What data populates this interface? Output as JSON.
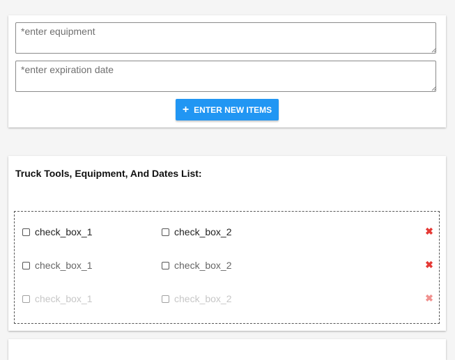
{
  "form": {
    "equipment_placeholder": "*enter equipment",
    "expiration_placeholder": "*enter expiration date",
    "enter_button_label": "ENTER NEW ITEMS",
    "enter_button_icon": "+"
  },
  "list": {
    "title": "Truck Tools, Equipment, And Dates List:",
    "rows": [
      {
        "check1": "check_box_1",
        "check2": "check_box_2"
      },
      {
        "check1": "check_box_1",
        "check2": "check_box_2"
      },
      {
        "check1": "check_box_1",
        "check2": "check_box_2"
      }
    ],
    "delete_icon": "✖"
  },
  "colors": {
    "accent": "#2196f3",
    "delete": "#e53935",
    "background": "#f5f5f5"
  }
}
